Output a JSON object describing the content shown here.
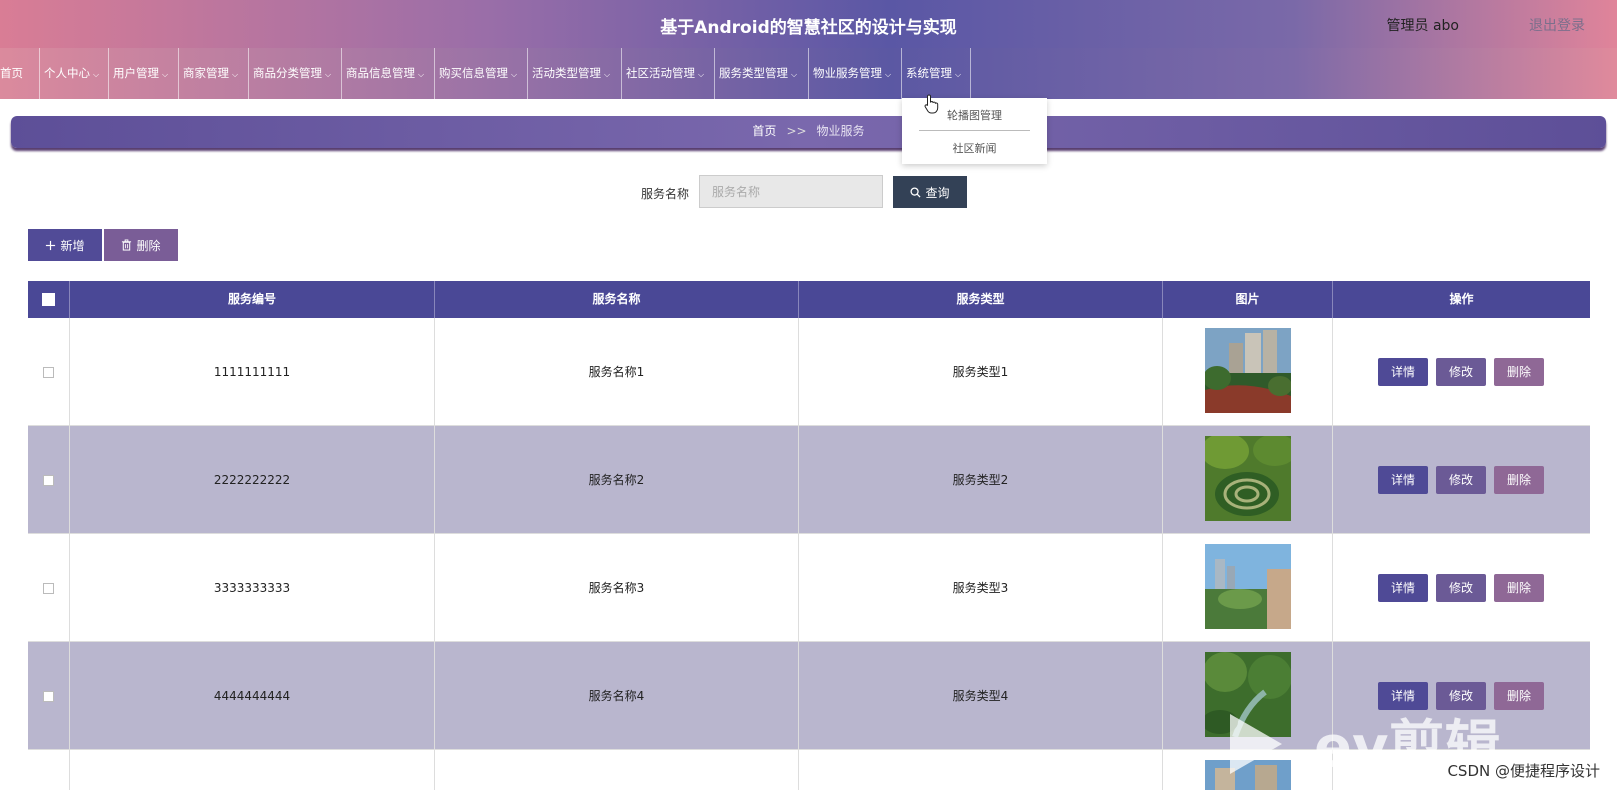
{
  "header": {
    "title": "基于Android的智慧社区的设计与实现",
    "admin": "管理员 abo",
    "logout": "退出登录"
  },
  "nav": [
    {
      "label": "首页"
    },
    {
      "label": "个人中心"
    },
    {
      "label": "用户管理"
    },
    {
      "label": "商家管理"
    },
    {
      "label": "商品分类管理"
    },
    {
      "label": "商品信息管理"
    },
    {
      "label": "购买信息管理"
    },
    {
      "label": "活动类型管理"
    },
    {
      "label": "社区活动管理"
    },
    {
      "label": "服务类型管理"
    },
    {
      "label": "物业服务管理"
    },
    {
      "label": "系统管理"
    }
  ],
  "dropdown": {
    "items": [
      "轮播图管理",
      "社区新闻"
    ]
  },
  "breadcrumb": {
    "home": "首页",
    "sep": ">>",
    "current": "物业服务"
  },
  "search": {
    "label": "服务名称",
    "placeholder": "服务名称",
    "button": "查询"
  },
  "actions": {
    "add": "新增",
    "delete": "删除"
  },
  "table": {
    "headers": [
      "服务编号",
      "服务名称",
      "服务类型",
      "图片",
      "操作"
    ],
    "rows": [
      {
        "id": "1111111111",
        "name": "服务名称1",
        "type": "服务类型1"
      },
      {
        "id": "2222222222",
        "name": "服务名称2",
        "type": "服务类型2"
      },
      {
        "id": "3333333333",
        "name": "服务名称3",
        "type": "服务类型3"
      },
      {
        "id": "4444444444",
        "name": "服务名称4",
        "type": "服务类型4"
      }
    ],
    "row_buttons": {
      "detail": "详情",
      "edit": "修改",
      "delete": "删除"
    }
  },
  "watermark": {
    "brand": "ev剪辑"
  },
  "footer_credit": "CSDN @便捷程序设计",
  "colors": {
    "nav_accent": "#514b97",
    "search_button": "#334156",
    "alt_row": "#b9b6ce"
  }
}
